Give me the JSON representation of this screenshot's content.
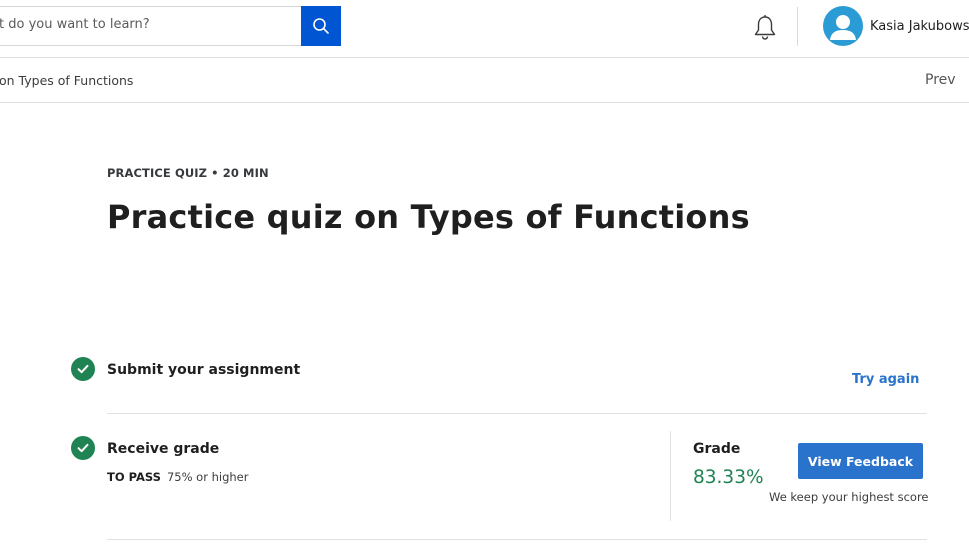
{
  "header": {
    "search": {
      "value": "t do you want to learn?"
    },
    "user": {
      "name": "Kasia Jakubowsk"
    }
  },
  "subheader": {
    "breadcrumb": "on Types of Functions",
    "prev_label": "Prev"
  },
  "main": {
    "eyebrow": "PRACTICE QUIZ • 20 MIN",
    "title": "Practice quiz on Types of Functions",
    "steps": [
      {
        "title": "Submit your assignment",
        "action_label": "Try again"
      },
      {
        "title": "Receive grade",
        "to_pass_label": "TO PASS",
        "to_pass_value": "75% or higher",
        "grade_label": "Grade",
        "grade_value": "83.33%",
        "feedback_label": "View Feedback",
        "note": "We keep your highest score"
      }
    ]
  },
  "colors": {
    "brand_blue": "#0056d2",
    "link_blue": "#2a73cc",
    "success_green": "#1f8354",
    "avatar_blue": "#2a9bd4"
  },
  "icons": [
    "search-icon",
    "bell-icon",
    "avatar-icon",
    "check-circle-icon"
  ]
}
